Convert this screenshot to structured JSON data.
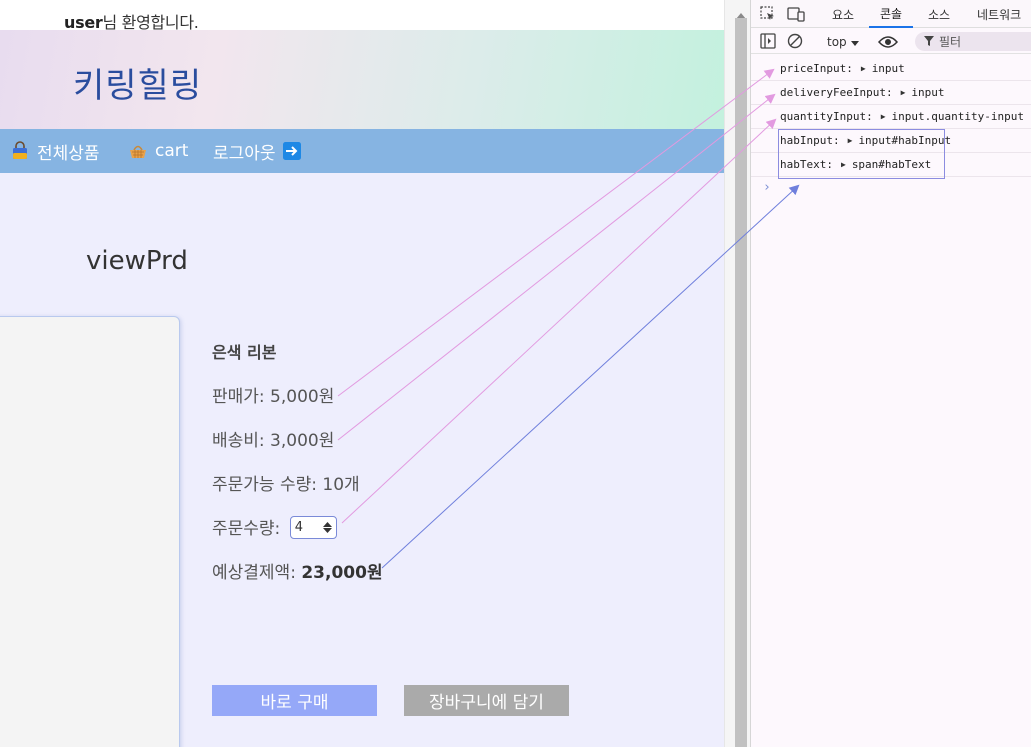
{
  "site": {
    "welcome_user": "user",
    "welcome_suffix": "님 환영합니다.",
    "brand": "키링힐링",
    "nav": {
      "all_products": "전체상품",
      "cart": "cart",
      "logout": "로그아웃"
    },
    "page_heading": "viewPrd"
  },
  "product": {
    "name": "은색 리본",
    "price_label": "판매가: 5,000원",
    "delivery_label": "배송비: 3,000원",
    "available_label": "주문가능 수량: 10개",
    "quantity_label": "주문수량:",
    "quantity_value": "4",
    "total_label": "예상결제액: ",
    "total_value": "23,000원"
  },
  "buttons": {
    "buy_now": "바로 구매",
    "add_to_cart": "장바구니에 담기"
  },
  "devtools": {
    "tabs": {
      "elements": "요소",
      "console": "콘솔",
      "sources": "소스",
      "network": "네트워크"
    },
    "context": "top",
    "filter_placeholder": "필터",
    "logs": [
      {
        "name": "priceInput:",
        "value": "input"
      },
      {
        "name": "deliveryFeeInput:",
        "value": "input"
      },
      {
        "name": "quantityInput:",
        "value": "input.quantity-input"
      },
      {
        "name": "habInput:",
        "value": "input#habInput"
      },
      {
        "name": "habText:",
        "value": "span#habText"
      }
    ],
    "prompt": "›"
  },
  "colors": {
    "brand": "#2a4d9e",
    "nav_bg": "#86b4e2",
    "content_bg": "#eeeefd",
    "buy_button": "#95a8f8",
    "cart_button": "#aaaaaa",
    "annotation_pink": "#e29ae0",
    "annotation_blue": "#6f7fdc"
  }
}
